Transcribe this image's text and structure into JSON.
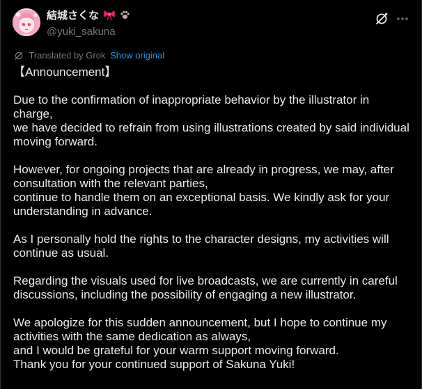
{
  "post": {
    "display_name": "結城さくな",
    "name_emoji": [
      "ribbon-icon",
      "paw-icon"
    ],
    "handle": "@yuki_sakuna",
    "translation": {
      "label": "Translated by Grok",
      "show_original": "Show original"
    },
    "paragraphs": [
      [
        "【Announcement】"
      ],
      [
        "Due to the confirmation of inappropriate behavior by the illustrator in charge,",
        "we have decided to refrain from using illustrations created by said individual moving forward."
      ],
      [
        "However, for ongoing projects that are already in progress, we may, after consultation with the relevant parties,",
        "continue to handle them on an exceptional basis. We kindly ask for your understanding in advance."
      ],
      [
        "As I personally hold the rights to the character designs, my activities will continue as usual."
      ],
      [
        "Regarding the visuals used for live broadcasts, we are currently in careful discussions, including the possibility of engaging a new illustrator."
      ],
      [
        "We apologize for this sudden announcement, but I hope to continue my activities with the same dedication as always,",
        "and I would be grateful for your warm support moving forward.",
        "Thank you for your continued support of Sakuna Yuki!"
      ]
    ]
  },
  "colors": {
    "background": "#000000",
    "text": "#e7e9ea",
    "muted": "#71767b",
    "link": "#1d9bf0",
    "ribbon": "#e0245e",
    "paw": "#c9a9a6"
  }
}
